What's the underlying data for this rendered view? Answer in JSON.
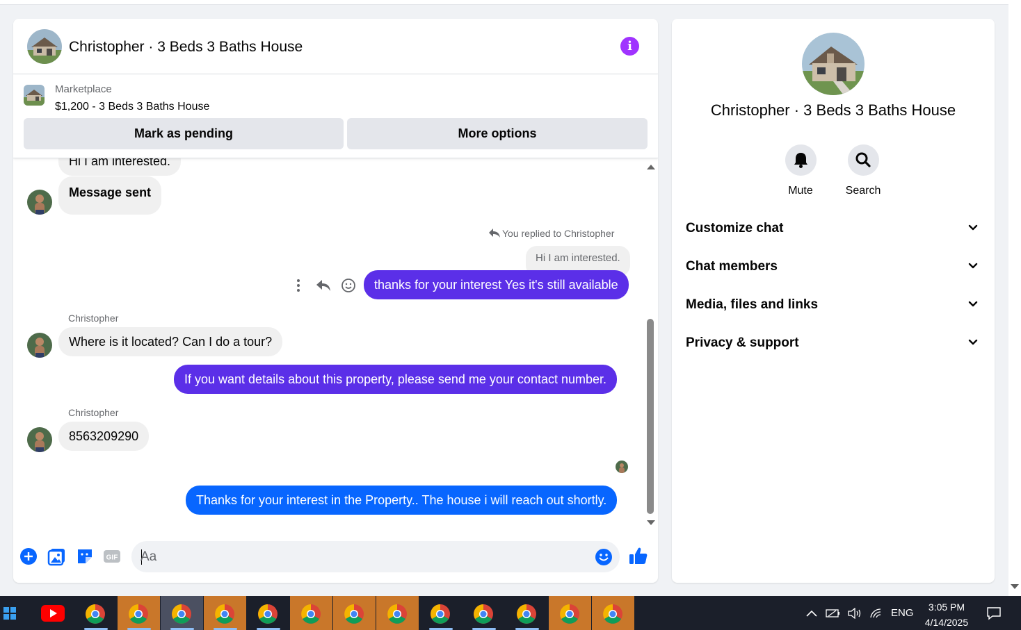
{
  "chat": {
    "title": "Christopher · 3 Beds 3 Baths House",
    "info_icon": "info-icon",
    "marketplace": {
      "label": "Marketplace",
      "listing": "$1,200 - 3 Beds 3 Baths House",
      "mark_pending": "Mark as pending",
      "more_options": "More options"
    },
    "messages": {
      "partial_top": "Hi I am interested.",
      "message_sent": "Message sent",
      "reply_note": "You replied to Christopher",
      "quoted": "Hi I am interested.",
      "reply_1": "thanks for your interest Yes it's still available",
      "sender_1": "Christopher",
      "incoming_2": "Where is it located? Can I do a tour?",
      "reply_2": "If you want details about this property, please send me your contact number.",
      "sender_2": "Christopher",
      "incoming_3": "8563209290",
      "reply_3": "Thanks for your interest in the Property.. The house i will reach  out shortly."
    },
    "composer": {
      "placeholder": "Aa"
    }
  },
  "sidebar": {
    "title": "Christopher · 3 Beds 3 Baths House",
    "actions": [
      {
        "label": "Mute",
        "icon": "bell-icon"
      },
      {
        "label": "Search",
        "icon": "search-icon"
      }
    ],
    "sections": [
      {
        "label": "Customize chat"
      },
      {
        "label": "Chat members"
      },
      {
        "label": "Media, files and links"
      },
      {
        "label": "Privacy & support"
      }
    ]
  },
  "taskbar": {
    "language": "ENG",
    "time": "3:05 PM",
    "date": "4/14/2025"
  },
  "colors": {
    "outgoing": "#5b2fe8",
    "outgoing_latest": "#0866ff",
    "accent_blue": "#0866ff",
    "info_purple": "#a033ff",
    "taskbar_active": "#c9772a"
  }
}
